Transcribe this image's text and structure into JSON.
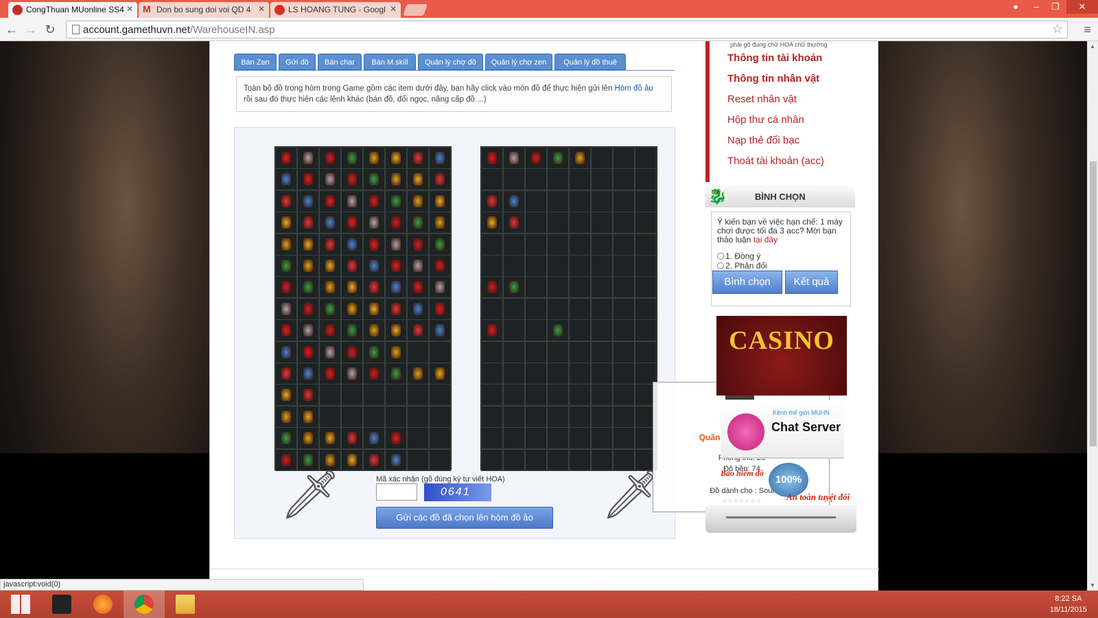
{
  "browser": {
    "tabs": [
      {
        "label": "CongThuan MUonline SS4",
        "active": true
      },
      {
        "label": "Don bo sung doi voi QD 4",
        "active": false
      },
      {
        "label": "LS HOANG TUNG - Googl",
        "active": false
      }
    ],
    "url_host": "account.gamethuvn.net",
    "url_path": "/WarehouseIN.asp",
    "status_text": "javascript:void(0)"
  },
  "page_tabs": [
    "Bán Zen",
    "Gửi đồ",
    "Bán char",
    "Bán M.skill",
    "Quản lý chợ đồ",
    "Quản lý chợ zen",
    "Quản lý đồ thuê"
  ],
  "info": {
    "text_before": "Toàn bộ đồ trong hòm trong Game gồm các item dưới đây, bạn hãy click vào món đồ để thực hiện gửi lên ",
    "link": "Hòm đồ ảo",
    "text_after": "rồi sau đó thực hiện các lệnh khác (bán đồ, đổi ngọc, nâng cấp đồ ...)"
  },
  "form": {
    "captcha_label": "Mã xác nhận (gõ đúng ký tự viết HOA)",
    "captcha_text": "0641",
    "submit_label": "Gửi các đồ đã chọn lên hòm đồ ảo"
  },
  "tooltip": {
    "name": "Quần ánh trăng (soul)",
    "defense": "Phòng thủ: 25",
    "durability": "Độ bền: 74",
    "for_class": "Đồ dành cho : Soul",
    "stars": "☆☆☆☆☆☆☆"
  },
  "sidebar": {
    "note": "phải gõ đúng chữ HOA chữ thường",
    "links": [
      "Thông tin tài khoản",
      "Thông tin nhân vật",
      "Reset nhân vật",
      "Hộp thư cá nhân",
      "Nạp thẻ đổi bạc",
      "Thoát tài khoản (acc)"
    ],
    "vote_title": "BÌNH CHỌN",
    "vote_question": "Ý kiến bạn về việc hạn chế: 1 máy chơi được tối đa 3 acc? Mời bạn thảo luận ",
    "vote_link": "tại đây",
    "vote_options": [
      "1. Đồng ý",
      "2. Phản đối"
    ],
    "vote_button": "Bình chọn",
    "result_button": "Kết quả",
    "ad_casino": "CASINO",
    "ad_chat_sub": "Kênh thế giới MUHN",
    "ad_chat_main": "Chat Server",
    "ad_insurance_1": "Bảo hiểm đồ",
    "ad_insurance_seal": "100%",
    "ad_insurance_2": "An toàn tuyệt đối"
  },
  "taskbar": {
    "time": "8:22 SA",
    "date": "18/11/2015"
  },
  "colors": {
    "accent_red": "#b82424",
    "tab_blue": "#5a8fd0",
    "item_name": "#e8581c",
    "chrome_frame": "#e95b48"
  }
}
